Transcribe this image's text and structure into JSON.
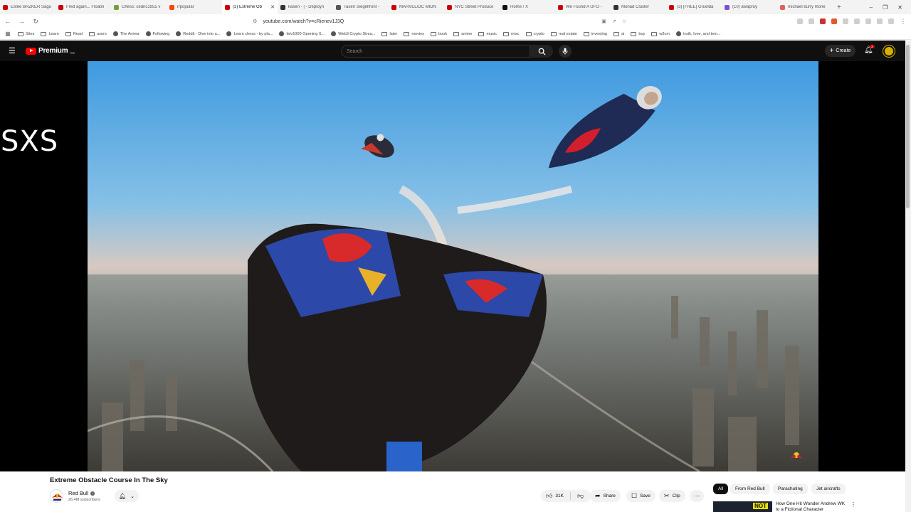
{
  "browser": {
    "tabs": [
      {
        "title": "Estée BRZKER Sagu",
        "color": "#cc0000"
      },
      {
        "title": "Fred again... Floatin",
        "color": "#cc0000"
      },
      {
        "title": "Chess: cedric1955 v",
        "color": "#7a9e3c"
      },
      {
        "title": "r/popular",
        "color": "#ff4500"
      },
      {
        "title": "(3) Extreme Ob",
        "color": "#cc0000"
      },
      {
        "title": "kasen - | - Deployn",
        "color": "#333333"
      },
      {
        "title": "Tasen Siegelfront -",
        "color": "#555555"
      },
      {
        "title": "MARVEL/DC MIDN",
        "color": "#cc0000"
      },
      {
        "title": "NYC Street Produce",
        "color": "#cc0000"
      },
      {
        "title": "Home / X",
        "color": "#111111"
      },
      {
        "title": "We Found A UFO -",
        "color": "#cc0000"
      },
      {
        "title": "Monad Cluster",
        "color": "#333333"
      },
      {
        "title": "(3) [FREE] Gruelda",
        "color": "#cc0000"
      },
      {
        "title": "(10) awaproy",
        "color": "#7b4fd6"
      },
      {
        "title": "michael burry mone",
        "color": "#e06060"
      }
    ],
    "active_tab_index": 4,
    "new_tab": "+",
    "window_controls": [
      "–",
      "❐",
      "✕"
    ],
    "url": "youtube.com/watch?v=cRienev1J3Q",
    "bookmarks": [
      {
        "label": "Sites",
        "kind": "folder"
      },
      {
        "label": "Learn",
        "kind": "folder"
      },
      {
        "label": "Read",
        "kind": "folder"
      },
      {
        "label": "users",
        "kind": "folder"
      },
      {
        "label": "The Anima",
        "kind": "site"
      },
      {
        "label": "Following",
        "kind": "site"
      },
      {
        "label": "Reddit - Dive into a...",
        "kind": "site"
      },
      {
        "label": "Learn chess - by pla...",
        "kind": "site"
      },
      {
        "label": "kdv1000 Opening S...",
        "kind": "site"
      },
      {
        "label": "Web3 Crypto Strea...",
        "kind": "site"
      },
      {
        "label": "later",
        "kind": "folder"
      },
      {
        "label": "movies",
        "kind": "folder"
      },
      {
        "label": "book",
        "kind": "folder"
      },
      {
        "label": "anime",
        "kind": "folder"
      },
      {
        "label": "music",
        "kind": "folder"
      },
      {
        "label": "misc",
        "kind": "folder"
      },
      {
        "label": "crypto",
        "kind": "folder"
      },
      {
        "label": "real estate",
        "kind": "folder"
      },
      {
        "label": "investing",
        "kind": "folder"
      },
      {
        "label": "ai",
        "kind": "folder"
      },
      {
        "label": "buy",
        "kind": "folder"
      },
      {
        "label": "w3cm",
        "kind": "folder"
      },
      {
        "label": "truth, love, and tem...",
        "kind": "site"
      }
    ]
  },
  "youtube": {
    "logo_text": "Premium",
    "logo_region": "GB",
    "search_placeholder": "Search",
    "create_label": "Create",
    "notification_count": "3",
    "overlay_text": "SXS",
    "video_title": "Extreme Obstacle Course In The Sky",
    "channel_name": "Red Bull",
    "subscribers": "26.4M subscribers",
    "like_count": "31K",
    "share_label": "Share",
    "save_label": "Save",
    "clip_label": "Clip",
    "chips": [
      "All",
      "From Red Bull",
      "Parachuting",
      "Jet aircrafts"
    ],
    "recommendation": {
      "title": "How One Hit Wonder Andrew WK to a Fictional Character",
      "thumb_badge": "NOT"
    }
  },
  "colors": {
    "brand_red": "#ff0000",
    "header_bg": "#0f0f0f",
    "chip_selected": "#0f0f0f"
  },
  "icons": [
    "menu-icon",
    "search-icon",
    "mic-icon",
    "bell-icon",
    "like-icon",
    "dislike-icon",
    "share-icon",
    "save-icon",
    "clip-icon",
    "more-icon"
  ]
}
